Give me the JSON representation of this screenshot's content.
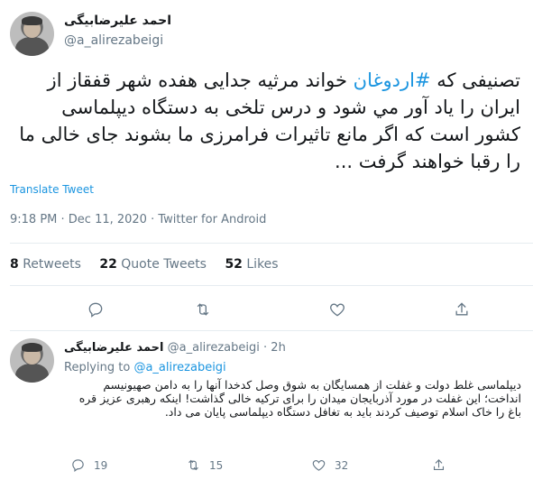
{
  "tweet": {
    "author_name": "احمد علیرضابیگی",
    "handle": "@a_alirezabeigi",
    "text_before": "تصنیفی که ",
    "hashtag": "#اردوغان",
    "text_after": " خواند مرثیه جدایی هفده شهر قفقاز از ایران را یاد آور مي شود و درس تلخی به دستگاه دیپلماسی کشور است که اگر مانع تاثیرات فرامرزی ما بشوند جای خالی ما را رقبا خواهند گرفت ...",
    "translate_label": "Translate Tweet",
    "meta": "9:18 PM · Dec 11, 2020 · Twitter for Android",
    "stats": {
      "retweets_count": "8",
      "retweets_label": "Retweets",
      "quotes_count": "22",
      "quotes_label": "Quote Tweets",
      "likes_count": "52",
      "likes_label": "Likes"
    }
  },
  "reply": {
    "author_name": "احمد علیرضابیگی",
    "handle": "@a_alirezabeigi",
    "time": "2h",
    "separator": "·",
    "replying_label": "Replying to",
    "replying_handle": "@a_alirezabeigi",
    "text": "دیپلماسی غلط دولت و غفلت از  همسایگان به شوق وصل کدخدا آنها را به دامن صهیونیسم انداخت؛ این غفلت در مورد آذربایجان میدان را برای ترکیه خالی گذاشت! اینکه رهبری عزیز قره باغ را خاک اسلام توصیف کردند باید به تغافل دستگاه دیپلماسی پایان می داد.",
    "reply_count": "19",
    "retweet_count": "15",
    "like_count": "32"
  },
  "icons": {
    "reply": "reply-icon",
    "retweet": "retweet-icon",
    "like": "heart-icon",
    "share": "share-icon"
  },
  "colors": {
    "link": "#1b95e0",
    "secondary_text": "#657786",
    "divider": "#e6ecf0"
  }
}
